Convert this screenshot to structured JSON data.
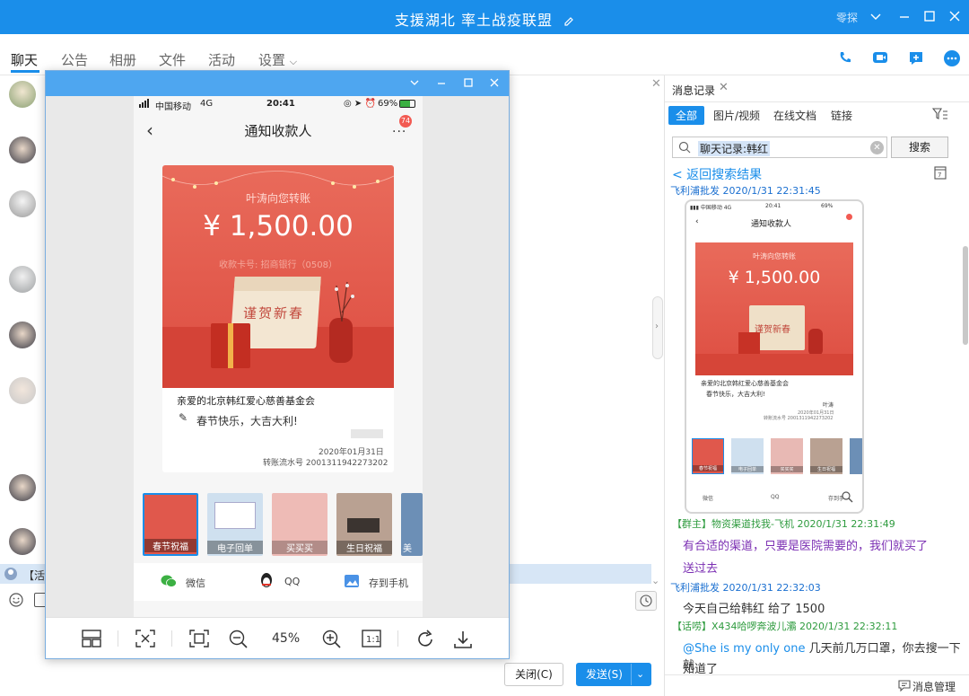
{
  "window": {
    "title": "支援湖北 率土战疫联盟",
    "user_label": "零探"
  },
  "tabs": [
    {
      "label": "聊天"
    },
    {
      "label": "公告"
    },
    {
      "label": "相册"
    },
    {
      "label": "文件"
    },
    {
      "label": "活动"
    },
    {
      "label": "设置"
    }
  ],
  "chat": {
    "banner_text": "【活跃",
    "close_label": "关闭(C)",
    "send_label": "发送(S)"
  },
  "viewer": {
    "zoom": "45%",
    "phone": {
      "carrier": "中国移动",
      "network": "4G",
      "time": "20:41",
      "battery": "69%",
      "page_title": "通知收款人",
      "badge": "74",
      "card_heading": "叶涛向您转账",
      "amount": "¥ 1,500.00",
      "account": "收款卡号: 招商银行（0508）",
      "calendar_text": "谨贺新春",
      "recipient": "亲爱的北京韩红爱心慈善基金会",
      "greeting": "春节快乐，大吉大利!",
      "date": "2020年01月31日",
      "serial": "转账流水号 2001311942273202",
      "thumbs": [
        "春节祝福",
        "电子回单",
        "买买买",
        "生日祝福",
        "美"
      ],
      "share": [
        "微信",
        "QQ",
        "存到手机"
      ]
    }
  },
  "history": {
    "panel_title": "消息记录",
    "filters": [
      "全部",
      "图片/视频",
      "在线文档",
      "链接"
    ],
    "search_value": "聊天记录:韩红",
    "search_button": "搜索",
    "back_link": "< 返回搜索结果",
    "mini": {
      "title": "通知收款人",
      "heading": "叶涛向您转账",
      "amount": "¥ 1,500.00",
      "calendar_text": "谨贺新春",
      "recipient": "亲爱的北京韩红爱心慈善基金会",
      "greeting": "春节快乐，大吉大利!",
      "sender": "叶涛",
      "thumbs": [
        "春节祝福",
        "电子回单",
        "买买买",
        "生日祝福"
      ],
      "share": [
        "微信",
        "QQ",
        "存到手"
      ]
    },
    "messages": [
      {
        "meta": "飞利浦批发 2020/1/31 22:31:45",
        "color": "#1a6fd0"
      },
      {
        "meta": "【群主】物资渠道找我-飞机 2020/1/31 22:31:49",
        "color": "#2e9b3e",
        "lines": [
          "有合适的渠道，只要是医院需要的，我们就买了",
          "送过去"
        ],
        "text_color": "#7b2fb3"
      },
      {
        "meta": "飞利浦批发 2020/1/31 22:32:03",
        "color": "#1a6fd0",
        "lines": [
          "今天自己给韩红 给了 1500"
        ],
        "text_color": "#333333"
      },
      {
        "meta": "【话唠】X434哈啰奔波儿灞 2020/1/31 22:32:11",
        "color": "#2e9b3e",
        "mention": "@She is my only one",
        "lines": [
          "几天前几万口罩，你去搜一下就",
          "知道了"
        ],
        "text_color": "#333333"
      }
    ],
    "manage_label": "消息管理"
  }
}
